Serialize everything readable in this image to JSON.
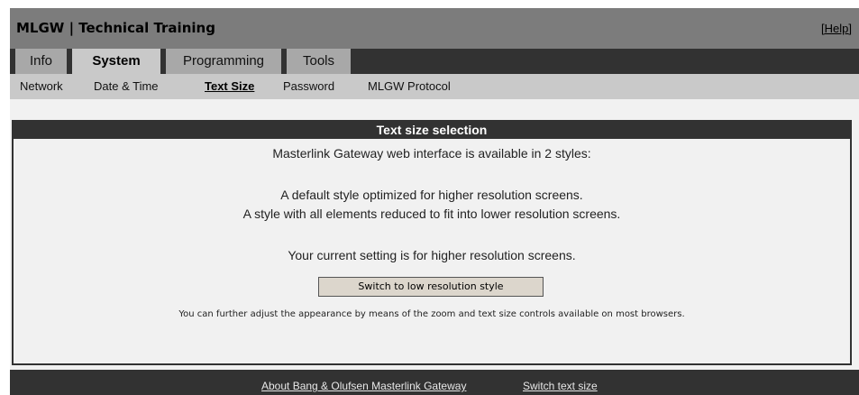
{
  "header": {
    "title": "MLGW | Technical Training",
    "help_label": "[Help]"
  },
  "tabs": [
    {
      "label": "Info",
      "active": false
    },
    {
      "label": "System",
      "active": true
    },
    {
      "label": "Programming",
      "active": false
    },
    {
      "label": "Tools",
      "active": false
    }
  ],
  "subnav": [
    {
      "label": "Network",
      "active": false
    },
    {
      "label": "Date & Time",
      "active": false
    },
    {
      "label": "Text Size",
      "active": true
    },
    {
      "label": "Password",
      "active": false
    },
    {
      "label": "MLGW Protocol",
      "active": false
    }
  ],
  "panel": {
    "title": "Text size selection",
    "intro": "Masterlink Gateway web interface is available in 2 styles:",
    "style_default": "A default style optimized for higher resolution screens.",
    "style_reduced": "A style with all elements reduced to fit into lower resolution screens.",
    "current_setting": "Your current setting is for higher resolution screens.",
    "switch_button": "Switch to low resolution style",
    "note": "You can further adjust the appearance by means of the zoom and text size controls available on most browsers."
  },
  "footer": {
    "about_link": "About Bang & Olufsen Masterlink Gateway",
    "switch_link": "Switch text size"
  }
}
